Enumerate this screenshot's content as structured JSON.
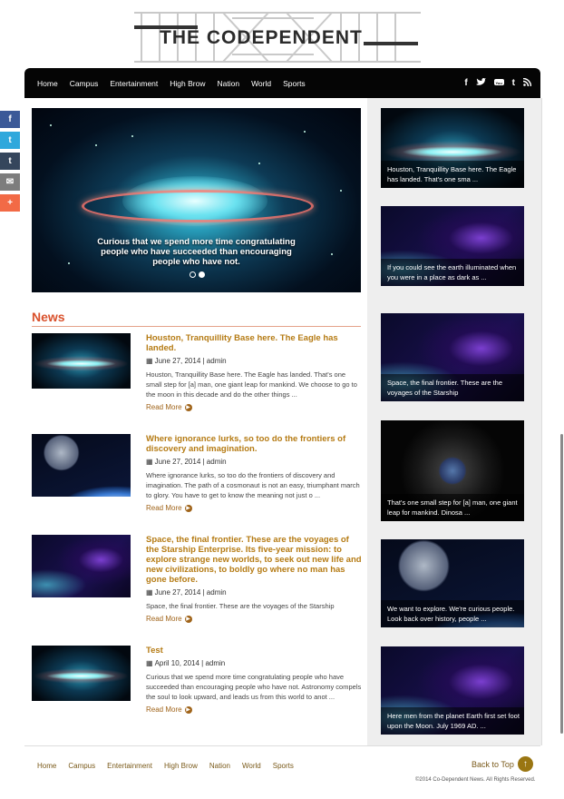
{
  "site": {
    "logo_text": "THE CODEPENDENT"
  },
  "nav": {
    "items": [
      "Home",
      "Campus",
      "Entertainment",
      "High Brow",
      "Nation",
      "World",
      "Sports"
    ],
    "social": [
      "f",
      "t",
      "yt",
      "t",
      "rss"
    ]
  },
  "slider": {
    "caption": "Curious that we spend more time congratulating people who have succeeded than encouraging people who have not."
  },
  "news": {
    "heading": "News",
    "read_more": "Read More",
    "articles": [
      {
        "title": "Houston, Tranquillity Base here. The Eagle has landed.",
        "meta": "June 27, 2014 | admin",
        "excerpt": "Houston, Tranquillity Base here. The Eagle has landed. That's one small step for [a] man, one giant leap for mankind. We choose to go to the moon in this decade and do the other things ...",
        "image": "galaxy"
      },
      {
        "title": "Where ignorance lurks, so too do the frontiers of discovery and imagination.",
        "meta": "June 27, 2014 | admin",
        "excerpt": "Where ignorance lurks, so too do the frontiers of discovery and imagination. The path of a cosmonaut is not an easy, triumphant march to glory. You have to get to know the meaning not just o ...",
        "image": "earth"
      },
      {
        "title": "Space, the final frontier. These are the voyages of the Starship Enterprise. Its five-year mission: to explore strange new worlds, to seek out new life and new civilizations, to boldly go where no man has gone before.",
        "meta": "June 27, 2014 | admin",
        "excerpt": "Space, the final frontier. These are the voyages of the Starship",
        "image": "nebula"
      },
      {
        "title": "Test",
        "meta": "April 10, 2014 | admin",
        "excerpt": "Curious that we spend more time congratulating people who have succeeded than encouraging people who have not. Astronomy compels the soul to look upward, and leads us from this world to anot ...",
        "image": "galaxy"
      }
    ]
  },
  "sidebar": {
    "cards": [
      {
        "caption": "Houston, Tranquillity Base here. The Eagle has landed. That's one sma ...",
        "image": "galaxy"
      },
      {
        "caption": "If you could see the earth illuminated when you were in a place as dark as ...",
        "image": "nebula"
      },
      {
        "caption": "Space, the final frontier. These are the voyages of the Starship",
        "image": "nebula"
      },
      {
        "caption": "That's one small step for [a] man, one giant leap for mankind. Dinosa ...",
        "image": "debris"
      },
      {
        "caption": "We want to explore. We're curious people. Look back over history, people ...",
        "image": "earth"
      },
      {
        "caption": "Here men from the planet Earth first set foot upon the Moon. July 1969 AD. ...",
        "image": "nebula"
      }
    ]
  },
  "share": {
    "items": [
      {
        "label": "f",
        "color": "#3b5998"
      },
      {
        "label": "t",
        "color": "#2fa8dc"
      },
      {
        "label": "t",
        "color": "#35465c"
      },
      {
        "label": "✉",
        "color": "#7d7d7d"
      },
      {
        "label": "+",
        "color": "#f26a46"
      }
    ]
  },
  "footer": {
    "links": [
      "Home",
      "Campus",
      "Entertainment",
      "High Brow",
      "Nation",
      "World",
      "Sports"
    ],
    "back_to_top": "Back to Top",
    "copyright": "©2014 Co-Dependent News. All Rights Reserved."
  }
}
